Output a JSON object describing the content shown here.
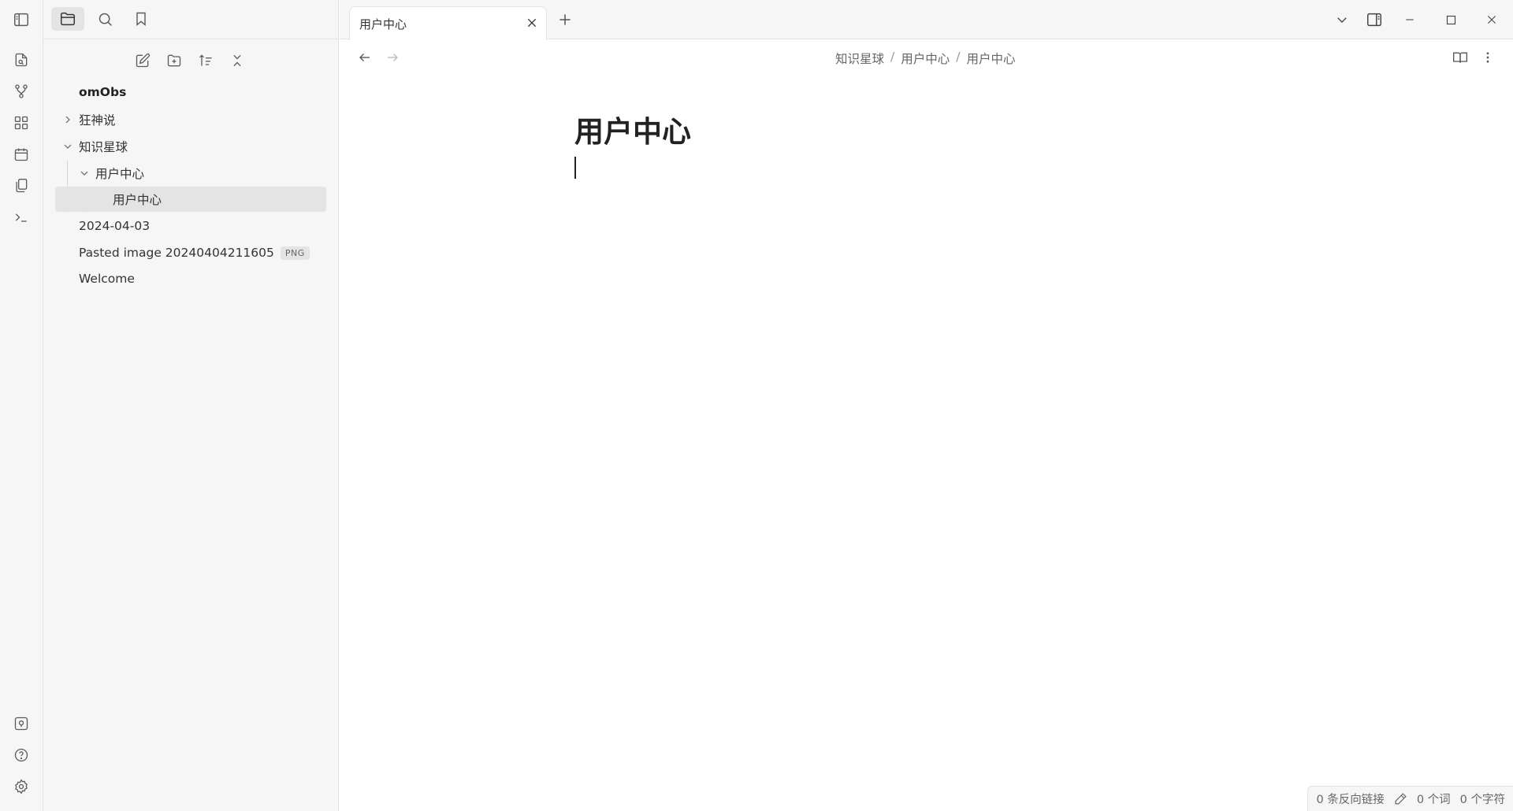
{
  "tab": {
    "title": "用户中心"
  },
  "sidebar": {
    "vault_name": "omObs",
    "tree": [
      {
        "label": "狂神说"
      },
      {
        "label": "知识星球"
      },
      {
        "label": "用户中心"
      },
      {
        "label": "用户中心"
      },
      {
        "label": "2024-04-03"
      },
      {
        "label": "Pasted image 20240404211605",
        "badge": "PNG"
      },
      {
        "label": "Welcome"
      }
    ]
  },
  "breadcrumb": [
    "知识星球",
    "用户中心",
    "用户中心"
  ],
  "breadcrumb_sep": "/",
  "editor": {
    "title": "用户中心"
  },
  "status": {
    "backlinks": "0 条反向链接",
    "words": "0 个词",
    "chars": "0 个字符"
  },
  "colors": {
    "sidebar_bg": "#f6f6f6",
    "selected_bg": "#e4e4e4",
    "text": "#222222"
  },
  "icons": {
    "ribbon_top": [
      "sidebar-toggle-icon",
      "open-quick-switcher-icon",
      "graph-view-icon",
      "canvas-icon",
      "daily-note-icon",
      "templates-icon",
      "command-palette-icon"
    ],
    "ribbon_bottom": [
      "vault-switcher-icon",
      "help-icon",
      "settings-icon"
    ]
  }
}
